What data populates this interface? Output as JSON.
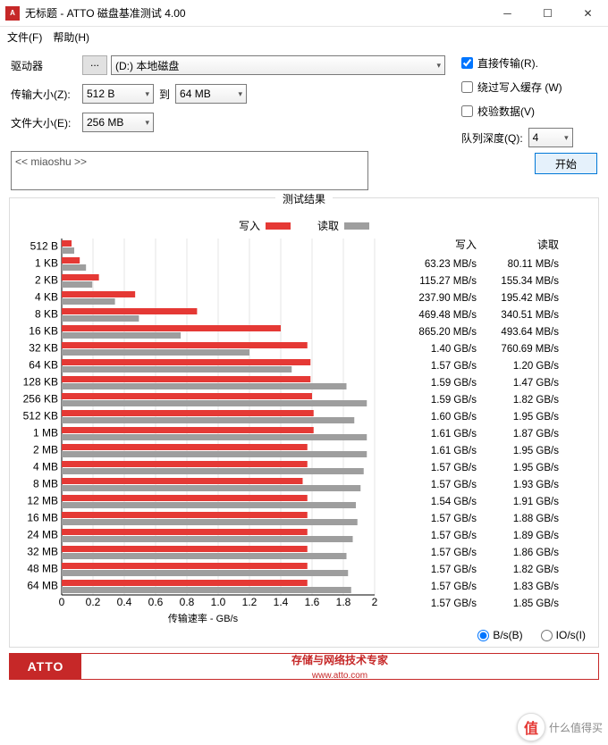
{
  "window": {
    "title": "无标题 - ATTO 磁盘基准测试 4.00"
  },
  "menu": {
    "file": "文件(F)",
    "help": "帮助(H)"
  },
  "form": {
    "drive_label": "驱动器",
    "drive_value": "(D:) 本地磁盘",
    "ellipsis": "...",
    "transfer_label": "传输大小(Z):",
    "transfer_from": "512 B",
    "to": "到",
    "transfer_to": "64 MB",
    "file_label": "文件大小(E):",
    "file_value": "256 MB"
  },
  "opts": {
    "direct": "直接传输(R).",
    "direct_chk": true,
    "bypass": "绕过写入缓存 (W)",
    "bypass_chk": false,
    "verify": "校验数据(V)",
    "verify_chk": false,
    "queue_label": "队列深度(Q):",
    "queue_val": "4"
  },
  "desc": "<< miaoshu >>",
  "start": "开始",
  "results": {
    "title": "测试结果",
    "write_label": "写入",
    "read_label": "读取",
    "x_axis": "传输速率 - GB/s",
    "ticks": [
      "0",
      "0.2",
      "0.4",
      "0.6",
      "0.8",
      "1.0",
      "1.2",
      "1.4",
      "1.6",
      "1.8",
      "2"
    ],
    "unit_bs": "B/s(B)",
    "unit_ios": "IO/s(I)"
  },
  "chart_data": {
    "type": "bar",
    "xlabel": "传输速率 - GB/s",
    "xlim": [
      0,
      2
    ],
    "categories": [
      "512 B",
      "1 KB",
      "2 KB",
      "4 KB",
      "8 KB",
      "16 KB",
      "32 KB",
      "64 KB",
      "128 KB",
      "256 KB",
      "512 KB",
      "1 MB",
      "2 MB",
      "4 MB",
      "8 MB",
      "12 MB",
      "16 MB",
      "24 MB",
      "32 MB",
      "48 MB",
      "64 MB"
    ],
    "series": [
      {
        "name": "写入",
        "color": "#e53935",
        "values_gb": [
          0.06323,
          0.11527,
          0.2379,
          0.46948,
          0.8652,
          1.4,
          1.57,
          1.59,
          1.59,
          1.6,
          1.61,
          1.61,
          1.57,
          1.57,
          1.54,
          1.57,
          1.57,
          1.57,
          1.57,
          1.57,
          1.57
        ],
        "display": [
          "63.23 MB/s",
          "115.27 MB/s",
          "237.90 MB/s",
          "469.48 MB/s",
          "865.20 MB/s",
          "1.40 GB/s",
          "1.57 GB/s",
          "1.59 GB/s",
          "1.59 GB/s",
          "1.60 GB/s",
          "1.61 GB/s",
          "1.61 GB/s",
          "1.57 GB/s",
          "1.57 GB/s",
          "1.54 GB/s",
          "1.57 GB/s",
          "1.57 GB/s",
          "1.57 GB/s",
          "1.57 GB/s",
          "1.57 GB/s",
          "1.57 GB/s"
        ]
      },
      {
        "name": "读取",
        "color": "#9e9e9e",
        "values_gb": [
          0.08011,
          0.15534,
          0.19542,
          0.34051,
          0.49364,
          0.76069,
          1.2,
          1.47,
          1.82,
          1.95,
          1.87,
          1.95,
          1.95,
          1.93,
          1.91,
          1.88,
          1.89,
          1.86,
          1.82,
          1.83,
          1.85
        ],
        "display": [
          "80.11 MB/s",
          "155.34 MB/s",
          "195.42 MB/s",
          "340.51 MB/s",
          "493.64 MB/s",
          "760.69 MB/s",
          "1.20 GB/s",
          "1.47 GB/s",
          "1.82 GB/s",
          "1.95 GB/s",
          "1.87 GB/s",
          "1.95 GB/s",
          "1.95 GB/s",
          "1.93 GB/s",
          "1.91 GB/s",
          "1.88 GB/s",
          "1.89 GB/s",
          "1.86 GB/s",
          "1.82 GB/s",
          "1.83 GB/s",
          "1.85 GB/s"
        ]
      }
    ]
  },
  "banner": {
    "brand": "ATTO",
    "slogan": "存储与网络技术专家",
    "url": "www.atto.com"
  },
  "watermark": "什么值得买"
}
